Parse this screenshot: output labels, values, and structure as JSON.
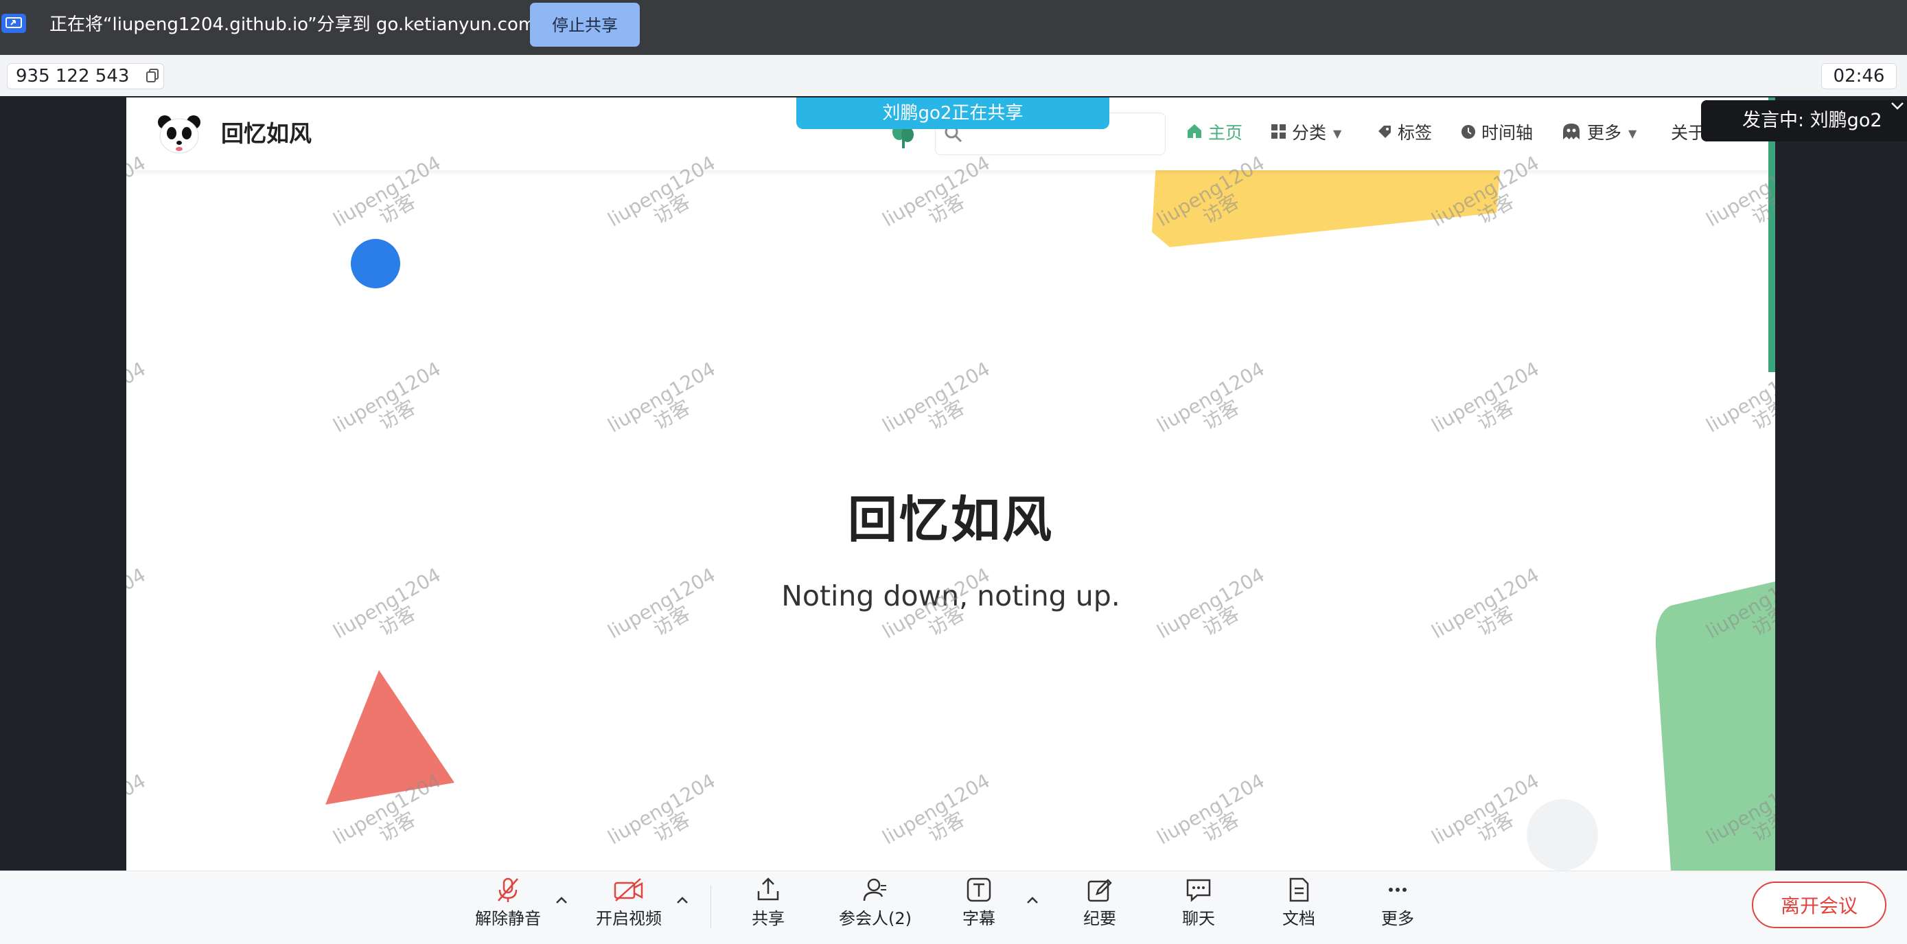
{
  "notification_bar": {
    "share_message": "正在将“liupeng1204.github.io”分享到 go.ketianyun.com",
    "stop_button": "停止共享",
    "icon": "screen-share-icon"
  },
  "meeting": {
    "meeting_id": "935 122 543",
    "elapsed_time": "02:46",
    "sharer_banner": "刘鹏go2正在共享",
    "active_speaker": "发言中: 刘鹏go2"
  },
  "shared_site": {
    "brand": "回忆如风",
    "nav": [
      {
        "label": "主页",
        "icon": "home-icon",
        "active": true
      },
      {
        "label": "分类",
        "icon": "grid-icon",
        "dropdown": true
      },
      {
        "label": "标签",
        "icon": "tag-icon"
      },
      {
        "label": "时间轴",
        "icon": "clock-icon"
      },
      {
        "label": "更多",
        "icon": "ghost-icon",
        "dropdown": true
      },
      {
        "label": "关于",
        "icon": ""
      }
    ],
    "hero_title": "回忆如风",
    "hero_subtitle": "Noting down, noting up.",
    "watermark_line1": "liupeng1204",
    "watermark_line2": "访客",
    "colors": {
      "accent": "#49b17f",
      "blue_dot": "#2b7de9",
      "yellow_shape": "#fdd66a",
      "red_triangle": "#ef766c",
      "green_shape": "#8fd19e"
    }
  },
  "toolbar": {
    "unmute": "解除静音",
    "start_video": "开启视频",
    "share": "共享",
    "participants": "参会人(2)",
    "captions": "字幕",
    "minutes": "纪要",
    "chat": "聊天",
    "docs": "文档",
    "more": "更多",
    "leave": "离开会议"
  },
  "colors": {
    "danger": "#e0443e",
    "primary": "#2f6fed"
  }
}
